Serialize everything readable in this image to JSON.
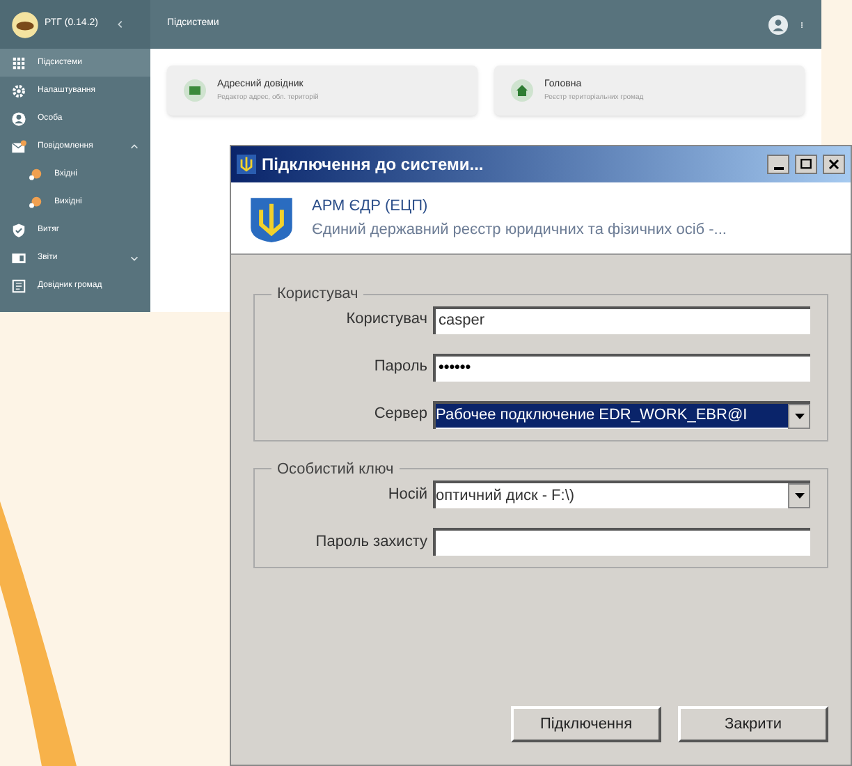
{
  "web_app": {
    "app_name": "РТГ (0.14.2)",
    "page_title": "Підсистеми",
    "sidebar": {
      "items": [
        {
          "label": "Підсистеми",
          "kind": "grid",
          "selected": true
        },
        {
          "label": "Налаштування",
          "kind": "gear",
          "selected": false
        },
        {
          "label": "Особа",
          "kind": "person",
          "selected": false
        },
        {
          "label": "Повідомлення",
          "kind": "mail",
          "selected": false,
          "expanded": true,
          "children": [
            {
              "label": "Вхідні",
              "kind": "dot",
              "selected": false
            },
            {
              "label": "Вихідні",
              "kind": "dot",
              "selected": false
            }
          ]
        },
        {
          "label": "Витяг",
          "kind": "shield",
          "selected": false
        },
        {
          "label": "Звіти",
          "kind": "report",
          "selected": false,
          "expanded": false
        },
        {
          "label": "Довідник громад",
          "kind": "book",
          "selected": false
        }
      ]
    },
    "cards": [
      {
        "title": "Адресний довідник",
        "subtitle": "Редактор адрес, обл. територій",
        "kind": "map"
      },
      {
        "title": "Головна",
        "subtitle": "Реєстр територіальних громад",
        "kind": "home"
      }
    ]
  },
  "dialog": {
    "title": "Підключення до системи...",
    "header": {
      "title": "АРМ ЄДР (ЕЦП)",
      "subtitle": "Єдиний державний реєстр юридичних та фізичних осіб -..."
    },
    "groups": [
      {
        "legend": "Користувач",
        "fields": [
          {
            "label": "Користувач",
            "kind": "text",
            "value": "casper"
          },
          {
            "label": "Пароль",
            "kind": "password",
            "value": "••••••"
          },
          {
            "label": "Сервер",
            "kind": "select",
            "value": "Рабочее подключение EDR_WORK_EBR@I",
            "selected": true
          }
        ]
      },
      {
        "legend": "Особистий ключ",
        "fields": [
          {
            "label": "Носій",
            "kind": "select",
            "value": "оптичний диск - F:\\)",
            "selected": false
          },
          {
            "label": "Пароль захисту",
            "kind": "password"
          }
        ]
      }
    ],
    "buttons": [
      "Підключення",
      "Закрити"
    ]
  }
}
